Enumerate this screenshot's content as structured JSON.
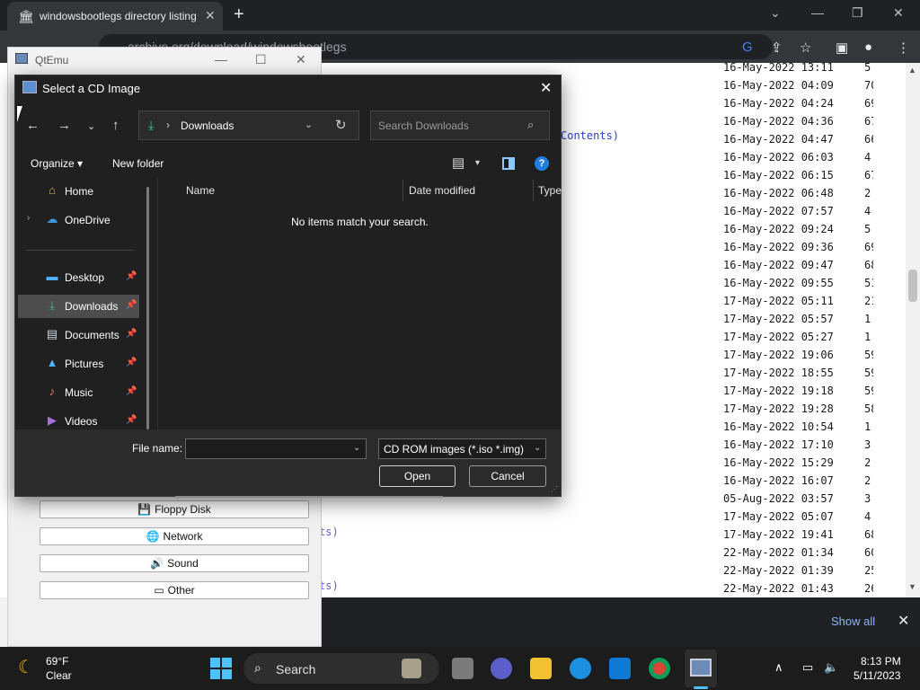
{
  "browser": {
    "tab_title": "windowsbootlegs directory listing",
    "url": "archive.org/download/windowsbootlegs",
    "new_tab": "+",
    "listing_dates": [
      "16-May-2022 13:11",
      "16-May-2022 04:09",
      "16-May-2022 04:24",
      "16-May-2022 04:36",
      "16-May-2022 04:47",
      "16-May-2022 06:03",
      "16-May-2022 06:15",
      "16-May-2022 06:48",
      "16-May-2022 07:57",
      "16-May-2022 09:24",
      "16-May-2022 09:36",
      "16-May-2022 09:47",
      "16-May-2022 09:55",
      "17-May-2022 05:11",
      "17-May-2022 05:57",
      "17-May-2022 05:27",
      "17-May-2022 19:06",
      "17-May-2022 18:55",
      "17-May-2022 19:18",
      "17-May-2022 19:28",
      "16-May-2022 10:54",
      "16-May-2022 17:10",
      "16-May-2022 15:29",
      "16-May-2022 16:07",
      "05-Aug-2022 03:57",
      "17-May-2022 05:07",
      "17-May-2022 19:41",
      "22-May-2022 01:34",
      "22-May-2022 01:39",
      "22-May-2022 01:43"
    ],
    "listing_sizes": [
      "5.",
      "70",
      "69",
      "67",
      "66",
      "4.",
      "67",
      "2.",
      "4.",
      "5.",
      "69",
      "68",
      "51",
      "21",
      "1.",
      "1.",
      "59",
      "59",
      "59",
      "58",
      "1.",
      "3.",
      "2.",
      "2.",
      "3.",
      "4.",
      "68",
      "60",
      "25",
      "26"
    ],
    "contents_link": "Contents)",
    "link_fragments": [
      "ts)",
      "ts)"
    ],
    "show_all": "Show all"
  },
  "qtemu": {
    "title": "QtEmu",
    "buttons": [
      {
        "label": "Floppy Disk",
        "icon": "floppy-icon"
      },
      {
        "label": "Network",
        "icon": "network-icon"
      },
      {
        "label": "Sound",
        "icon": "sound-icon"
      },
      {
        "label": "Other",
        "icon": "other-icon"
      }
    ]
  },
  "dialog": {
    "title": "Select a CD Image",
    "address": "Downloads",
    "search_placeholder": "Search Downloads",
    "organize": "Organize",
    "new_folder": "New folder",
    "help": "?",
    "nav_items": [
      {
        "label": "Home",
        "icon": "home-icon"
      },
      {
        "label": "OneDrive",
        "icon": "onedrive-icon"
      },
      {
        "label": "Desktop",
        "icon": "desktop-icon"
      },
      {
        "label": "Downloads",
        "icon": "downloads-icon"
      },
      {
        "label": "Documents",
        "icon": "documents-icon"
      },
      {
        "label": "Pictures",
        "icon": "pictures-icon"
      },
      {
        "label": "Music",
        "icon": "music-icon"
      },
      {
        "label": "Videos",
        "icon": "videos-icon"
      }
    ],
    "columns": {
      "name": "Name",
      "date": "Date modified",
      "type": "Type"
    },
    "empty_message": "No items match your search.",
    "file_name_label": "File name:",
    "file_name_value": "",
    "file_type": "CD ROM images (*.iso *.img)",
    "open": "Open",
    "cancel": "Cancel"
  },
  "taskbar": {
    "temperature": "69°F",
    "condition": "Clear",
    "search": "Search",
    "time": "8:13 PM",
    "date": "5/11/2023"
  },
  "colors": {
    "accent": "#4cc2ff",
    "dialog_bg": "#202020",
    "link": "#2a43c5"
  }
}
